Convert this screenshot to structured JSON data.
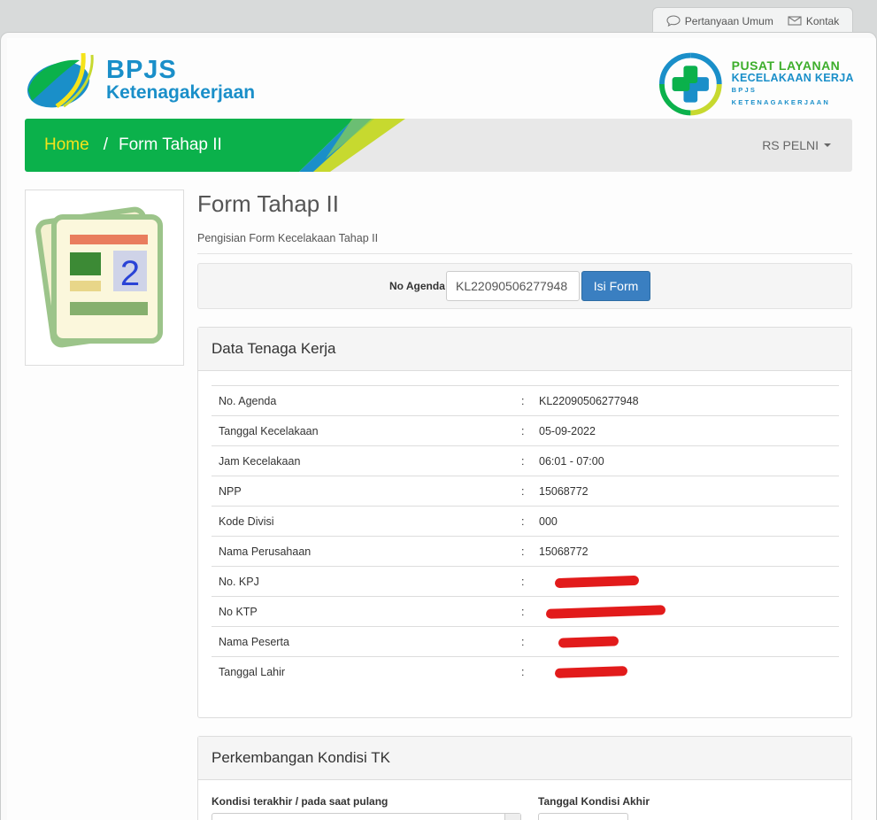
{
  "utility": {
    "faq_label": "Pertanyaan Umum",
    "contact_label": "Kontak"
  },
  "brand": {
    "bpjs_line1": "BPJS",
    "bpjs_line2": "Ketenagakerjaan",
    "pusat_line1": "PUSAT LAYANAN",
    "pusat_line2": "KECELAKAAN KERJA",
    "pusat_line3": "BPJS KETENAGAKERJAAN",
    "colors": {
      "green": "#0bb14b",
      "blue": "#1a8fc9",
      "yellow": "#f5e31a"
    }
  },
  "nav": {
    "home": "Home",
    "separator": "/",
    "current": "Form Tahap II",
    "user": "RS PELNI"
  },
  "page": {
    "title": "Form Tahap II",
    "subtitle": "Pengisian Form Kecelakaan Tahap II",
    "thumb_number": "2"
  },
  "search": {
    "label": "No Agenda",
    "value": "KL22090506277948",
    "button": "Isi Form"
  },
  "panel_data": {
    "heading": "Data Tenaga Kerja",
    "rows": [
      {
        "label": "No. Agenda",
        "sep": ":",
        "value": "KL22090506277948"
      },
      {
        "label": "Tanggal Kecelakaan",
        "sep": ":",
        "value": "05-09-2022"
      },
      {
        "label": "Jam Kecelakaan",
        "sep": ":",
        "value": "06:01 - 07:00"
      },
      {
        "label": "NPP",
        "sep": ":",
        "value": "15068772"
      },
      {
        "label": "Kode Divisi",
        "sep": ":",
        "value": "000"
      },
      {
        "label": "Nama Perusahaan",
        "sep": ":",
        "value": "15068772"
      },
      {
        "label": "No. KPJ",
        "sep": ":",
        "value": ""
      },
      {
        "label": "No KTP",
        "sep": ":",
        "value": ""
      },
      {
        "label": "Nama Peserta",
        "sep": ":",
        "value": ""
      },
      {
        "label": "Tanggal Lahir",
        "sep": ":",
        "value": ""
      }
    ]
  },
  "panel_kondisi": {
    "heading": "Perkembangan Kondisi TK",
    "field1_label": "Kondisi terakhir / pada saat pulang",
    "field2_label": "Tanggal Kondisi Akhir"
  }
}
